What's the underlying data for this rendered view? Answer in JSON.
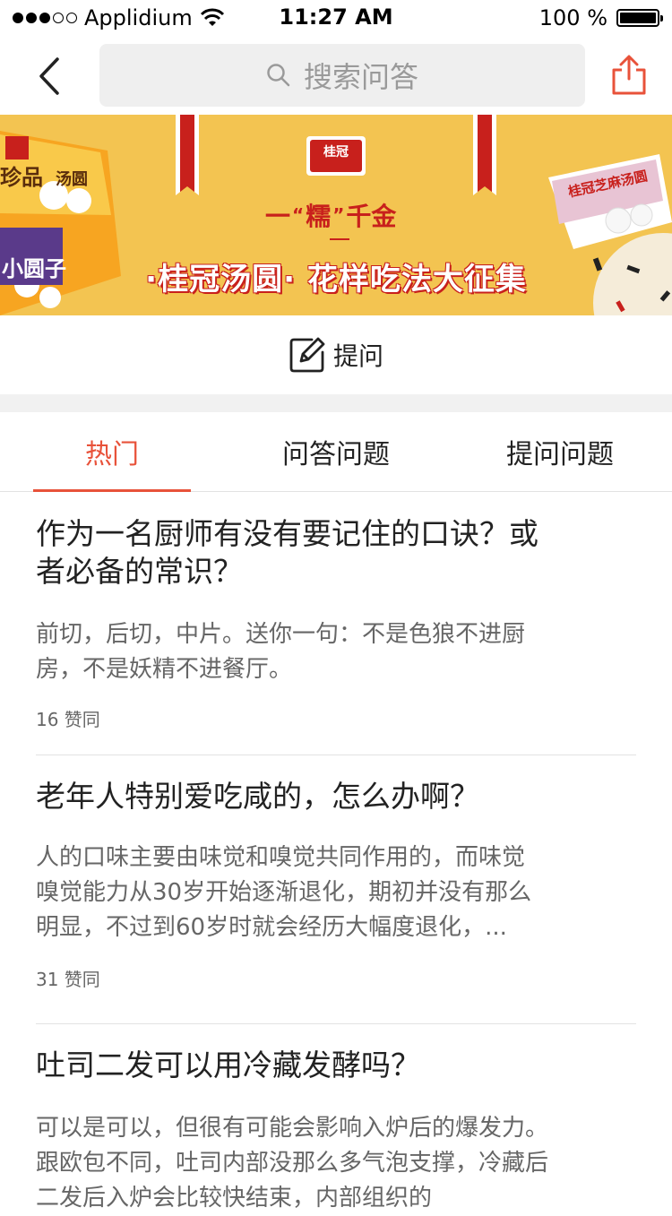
{
  "status_bar": {
    "carrier": "Applidium",
    "time": "11:27 AM",
    "battery": "100 %"
  },
  "nav": {
    "search_placeholder": "搜索问答",
    "back_icon": "chevron-left-icon",
    "share_icon": "share-icon"
  },
  "banner": {
    "logo_text": "桂冠",
    "slogan_quote": "糯",
    "slogan_prefix": "一",
    "slogan_suffix": "千金",
    "headline": "·桂冠汤圆· 花样吃法大征集",
    "left_pkg_line1": "珍品",
    "left_pkg_line2": "汤圆",
    "left_pkg_line3": "小圆子",
    "right_pkg_text": "桂冠芝麻汤圆"
  },
  "ask": {
    "label": "提问",
    "icon": "edit-icon"
  },
  "tabs": [
    {
      "label": "热门",
      "active": true
    },
    {
      "label": "问答问题",
      "active": false
    },
    {
      "label": "提问问题",
      "active": false
    }
  ],
  "items": [
    {
      "title_line1": "作为一名厨师有没有要记住的口诀？或",
      "title_line2": "者必备的常识？",
      "excerpt_line1": "前切，后切，中片。送你一句：不是色狼不进厨",
      "excerpt_line2": "房，不是妖精不进餐厅。",
      "likes": "16 赞同"
    },
    {
      "title_line1": "老年人特别爱吃咸的，怎么办啊？",
      "excerpt_line1": "人的口味主要由味觉和嗅觉共同作用的，而味觉",
      "excerpt_line2": "嗅觉能力从30岁开始逐渐退化，期初并没有那么",
      "excerpt_line3": "明显，不过到60岁时就会经历大幅度退化，...",
      "likes": "31 赞同"
    },
    {
      "title_line1": "吐司二发可以用冷藏发酵吗？",
      "excerpt_line1": "可以是可以，但很有可能会影响入炉后的爆发力。",
      "excerpt_line2": "跟欧包不同，吐司内部没那么多气泡支撑，冷藏后",
      "excerpt_line3": "二发后入炉会比较快结束，内部组织的"
    }
  ],
  "colors": {
    "accent": "#e8523a",
    "banner_bg": "#f3c451",
    "banner_red": "#c8201c"
  }
}
